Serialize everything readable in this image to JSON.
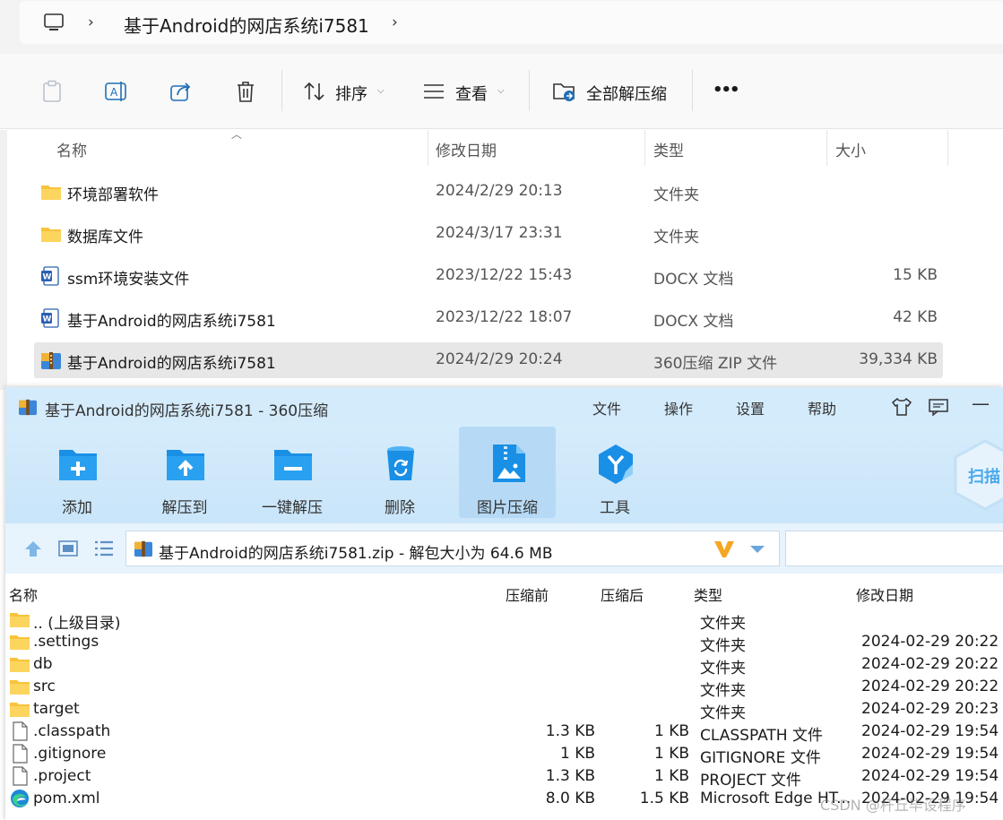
{
  "address": {
    "chevron": "›",
    "path_segment": "基于Android的网店系统i7581",
    "icons": [
      "computer-icon",
      "chevron-right-icon"
    ]
  },
  "command_bar": {
    "sort_label": "排序",
    "view_label": "查看",
    "extract_all_label": "全部解压缩",
    "more_label": "•••",
    "icons": [
      "paste-icon",
      "rename-icon",
      "share-icon",
      "delete-icon",
      "sort-icon",
      "view-icon",
      "extract-icon"
    ]
  },
  "file_list": {
    "columns": {
      "name": "名称",
      "modified": "修改日期",
      "type": "类型",
      "size": "大小"
    },
    "rows": [
      {
        "icon": "folder-icon",
        "name": "环境部署软件",
        "modified": "2024/2/29 20:13",
        "type": "文件夹",
        "size": ""
      },
      {
        "icon": "folder-icon",
        "name": "数据库文件",
        "modified": "2024/3/17 23:31",
        "type": "文件夹",
        "size": ""
      },
      {
        "icon": "word-doc-icon",
        "name": "ssm环境安装文件",
        "modified": "2023/12/22 15:43",
        "type": "DOCX 文档",
        "size": "15 KB"
      },
      {
        "icon": "word-doc-icon",
        "name": "基于Android的网店系统i7581",
        "modified": "2023/12/22 18:07",
        "type": "DOCX 文档",
        "size": "42 KB"
      },
      {
        "icon": "zip-archive-icon",
        "name": "基于Android的网店系统i7581",
        "modified": "2024/2/29 20:24",
        "type": "360压缩 ZIP 文件",
        "size": "39,334 KB",
        "selected": true
      }
    ]
  },
  "zip_window": {
    "title": "基于Android的网店系统i7581 - 360压缩",
    "menu": [
      "文件",
      "操作",
      "设置",
      "帮助"
    ],
    "menu_labels": {
      "file": "文件",
      "ops": "操作",
      "settings": "设置",
      "help": "帮助"
    },
    "toolbar": {
      "add": "添加",
      "extract_to": "解压到",
      "one_click_extract": "一键解压",
      "delete": "删除",
      "image_compress": "图片压缩",
      "tools": "工具"
    },
    "scan_badge": "扫描",
    "path_text": "基于Android的网店系统i7581.zip - 解包大小为 64.6 MB",
    "colors": {
      "title_bg": "#d4ebfb",
      "toolbar_bg": "#c9e5fa",
      "accent": "#1a8fe6"
    },
    "list_columns": {
      "name": "名称",
      "packed_before": "压缩前",
      "packed_after": "压缩后",
      "type": "类型",
      "modified": "修改日期"
    },
    "entries": [
      {
        "icon": "folder-icon",
        "name": ".. (上级目录)",
        "before": "",
        "after": "",
        "type": "文件夹",
        "modified": ""
      },
      {
        "icon": "folder-icon",
        "name": ".settings",
        "before": "",
        "after": "",
        "type": "文件夹",
        "modified": "2024-02-29 20:22"
      },
      {
        "icon": "folder-icon",
        "name": "db",
        "before": "",
        "after": "",
        "type": "文件夹",
        "modified": "2024-02-29 20:22"
      },
      {
        "icon": "folder-icon",
        "name": "src",
        "before": "",
        "after": "",
        "type": "文件夹",
        "modified": "2024-02-29 20:22"
      },
      {
        "icon": "folder-icon",
        "name": "target",
        "before": "",
        "after": "",
        "type": "文件夹",
        "modified": "2024-02-29 20:23"
      },
      {
        "icon": "file-icon",
        "name": ".classpath",
        "before": "1.3 KB",
        "after": "1 KB",
        "type": "CLASSPATH 文件",
        "modified": "2024-02-29 19:54"
      },
      {
        "icon": "file-icon",
        "name": ".gitignore",
        "before": "1 KB",
        "after": "1 KB",
        "type": "GITIGNORE 文件",
        "modified": "2024-02-29 19:54"
      },
      {
        "icon": "file-icon",
        "name": ".project",
        "before": "1.3 KB",
        "after": "1 KB",
        "type": "PROJECT 文件",
        "modified": "2024-02-29 19:54"
      },
      {
        "icon": "edge-icon",
        "name": "pom.xml",
        "before": "8.0 KB",
        "after": "1.5 KB",
        "type": "Microsoft Edge HT...",
        "modified": "2024-02-29 19:54"
      }
    ]
  },
  "watermark": "CSDN @杆丘毕设程序"
}
